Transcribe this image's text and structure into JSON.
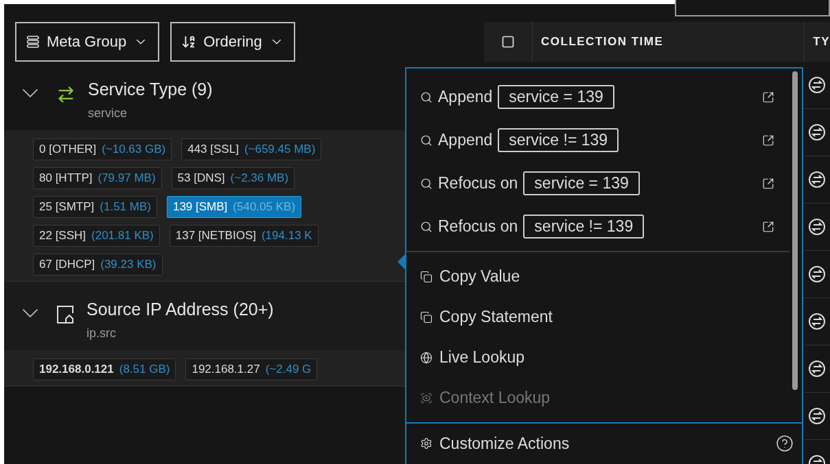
{
  "toolbar": {
    "buttons": [
      {
        "kind": "group",
        "label": "Meta Group"
      },
      {
        "kind": "order",
        "label": "Ordering"
      }
    ]
  },
  "groups": [
    {
      "kind": "service",
      "title": "Service Type (9)",
      "key": "service",
      "expanded": true,
      "chip_rows": [
        [
          {
            "value": "0 [OTHER]",
            "size": "(~10.63 GB)",
            "selected": false
          },
          {
            "value": "443 [SSL]",
            "size": "(~659.45 MB)",
            "selected": false
          }
        ],
        [
          {
            "value": "80 [HTTP]",
            "size": "(79.97 MB)",
            "selected": false
          },
          {
            "value": "53 [DNS]",
            "size": "(~2.36 MB)",
            "selected": false
          }
        ],
        [
          {
            "value": "25 [SMTP]",
            "size": "(1.51 MB)",
            "selected": false
          },
          {
            "value": "139 [SMB]",
            "size": "(540.05 KB)",
            "selected": true
          }
        ],
        [
          {
            "value": "22 [SSH]",
            "size": "(201.81 KB)",
            "selected": false
          },
          {
            "value": "137 [NETBIOS]",
            "size": "(194.13 K",
            "selected": false
          }
        ],
        [
          {
            "value": "67 [DHCP]",
            "size": "(39.23 KB)",
            "selected": false
          }
        ]
      ]
    },
    {
      "kind": "ip",
      "title": "Source IP Address (20+)",
      "key": "ip.src",
      "expanded": true,
      "chip_rows": [
        [
          {
            "value": "192.168.0.121",
            "size": "(8.51 GB)",
            "selected": false,
            "bold": true
          },
          {
            "value": "192.168.1.27",
            "size": "(~2.49 G",
            "selected": false,
            "bold": false
          }
        ]
      ]
    }
  ],
  "table": {
    "columns": [
      {
        "kind": "checkbox",
        "checked": false
      },
      {
        "kind": "text",
        "label": "COLLECTION TIME"
      },
      {
        "kind": "text",
        "label": "TY"
      }
    ],
    "rows": [
      {
        "kind": "exchange"
      },
      {
        "kind": "exchange"
      },
      {
        "kind": "exchange"
      },
      {
        "kind": "exchange"
      },
      {
        "kind": "exchange"
      },
      {
        "kind": "exchange"
      },
      {
        "kind": "exchange"
      },
      {
        "kind": "exchange"
      },
      {
        "kind": "exchange"
      }
    ]
  },
  "menu": {
    "query_items": [
      {
        "action": "Append",
        "expression": "service = 139"
      },
      {
        "action": "Append",
        "expression": "service != 139"
      },
      {
        "action": "Refocus on",
        "expression": "service = 139"
      },
      {
        "action": "Refocus on",
        "expression": "service != 139"
      }
    ],
    "action_items": [
      {
        "kind": "copy",
        "label": "Copy Value",
        "disabled": false
      },
      {
        "kind": "copy",
        "label": "Copy Statement",
        "disabled": false
      },
      {
        "kind": "live",
        "label": "Live Lookup",
        "disabled": false
      },
      {
        "kind": "context",
        "label": "Context Lookup",
        "disabled": true
      }
    ],
    "footer": {
      "label": "Customize Actions"
    }
  }
}
